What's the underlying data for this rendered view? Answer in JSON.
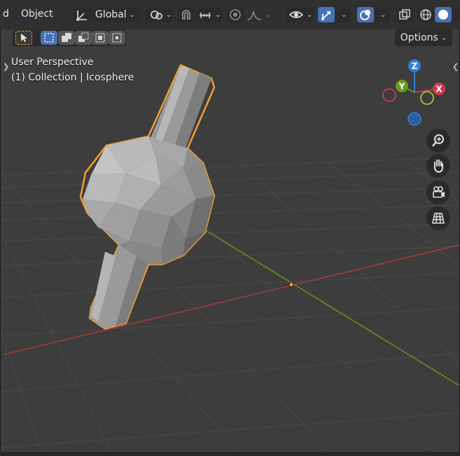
{
  "header": {
    "partial_menu": "d",
    "mode_label": "Object",
    "orientation_label": "Global",
    "options_label": "Options"
  },
  "overlay": {
    "view_name": "User Perspective",
    "collection_prefix": "(1) Collection",
    "separator": "|",
    "object_name": "Icosphere"
  },
  "gizmo": {
    "axis_z": "Z",
    "axis_y": "Y",
    "axis_x": "X",
    "color_x": "#cc3c4c",
    "color_y": "#6a9a1f",
    "color_z": "#2f7fd6"
  },
  "colors": {
    "accent": "#4772b3",
    "selection_outline": "#f0a030",
    "x_axis_line": "#a83a3a",
    "y_axis_line": "#6f8e1e"
  },
  "icons": {
    "transform_pivot": "pivot-icon",
    "snap": "magnet-icon",
    "proportional": "proportional-edit-icon",
    "visibility": "eye-icon",
    "gizmo_toggle": "gizmo-icon",
    "overlay_toggle": "overlays-icon",
    "xray": "xray-icon",
    "wireframe": "wireframe-shading-icon",
    "solid": "solid-shading-icon",
    "zoom": "zoom-icon",
    "pan": "hand-icon",
    "camera": "camera-icon",
    "grid": "ortho-grid-icon"
  }
}
